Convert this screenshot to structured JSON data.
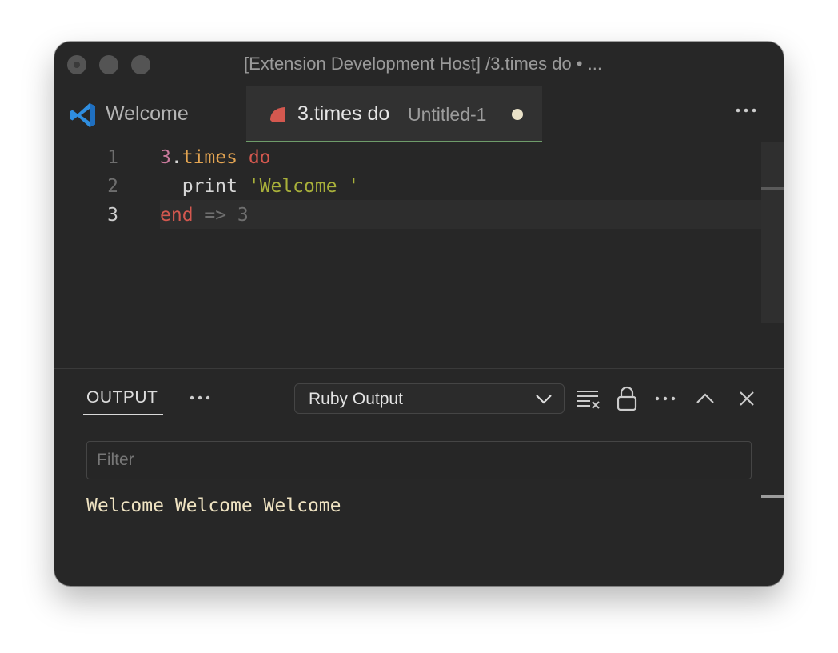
{
  "window": {
    "title": "[Extension Development Host] /3.times do • ..."
  },
  "tabs": [
    {
      "label": "Welcome",
      "icon": "vscode-icon"
    },
    {
      "label": "3.times do",
      "description": "Untitled-1",
      "icon": "ruby-icon",
      "active": true,
      "dirty": true
    }
  ],
  "editor": {
    "line_numbers": [
      "1",
      "2",
      "3"
    ],
    "lines": [
      [
        {
          "t": "3",
          "c": "num"
        },
        {
          "t": ".",
          "c": "ident"
        },
        {
          "t": "times",
          "c": "meth"
        },
        {
          "t": " ",
          "c": "ident"
        },
        {
          "t": "do",
          "c": "kw"
        }
      ],
      [
        {
          "t": "  print ",
          "c": "ident"
        },
        {
          "t": "'Welcome '",
          "c": "str"
        }
      ],
      [
        {
          "t": "end",
          "c": "kw"
        },
        {
          "t": " => 3",
          "c": "arrow"
        }
      ]
    ],
    "active_line": 3
  },
  "panel": {
    "tab_label": "OUTPUT",
    "channel": "Ruby Output",
    "filter_placeholder": "Filter",
    "output": "Welcome Welcome Welcome"
  },
  "colors": {
    "accent_tab": "#6e9c6a",
    "ruby": "#d4584f",
    "vscode_blue": "#2f8ee0"
  }
}
